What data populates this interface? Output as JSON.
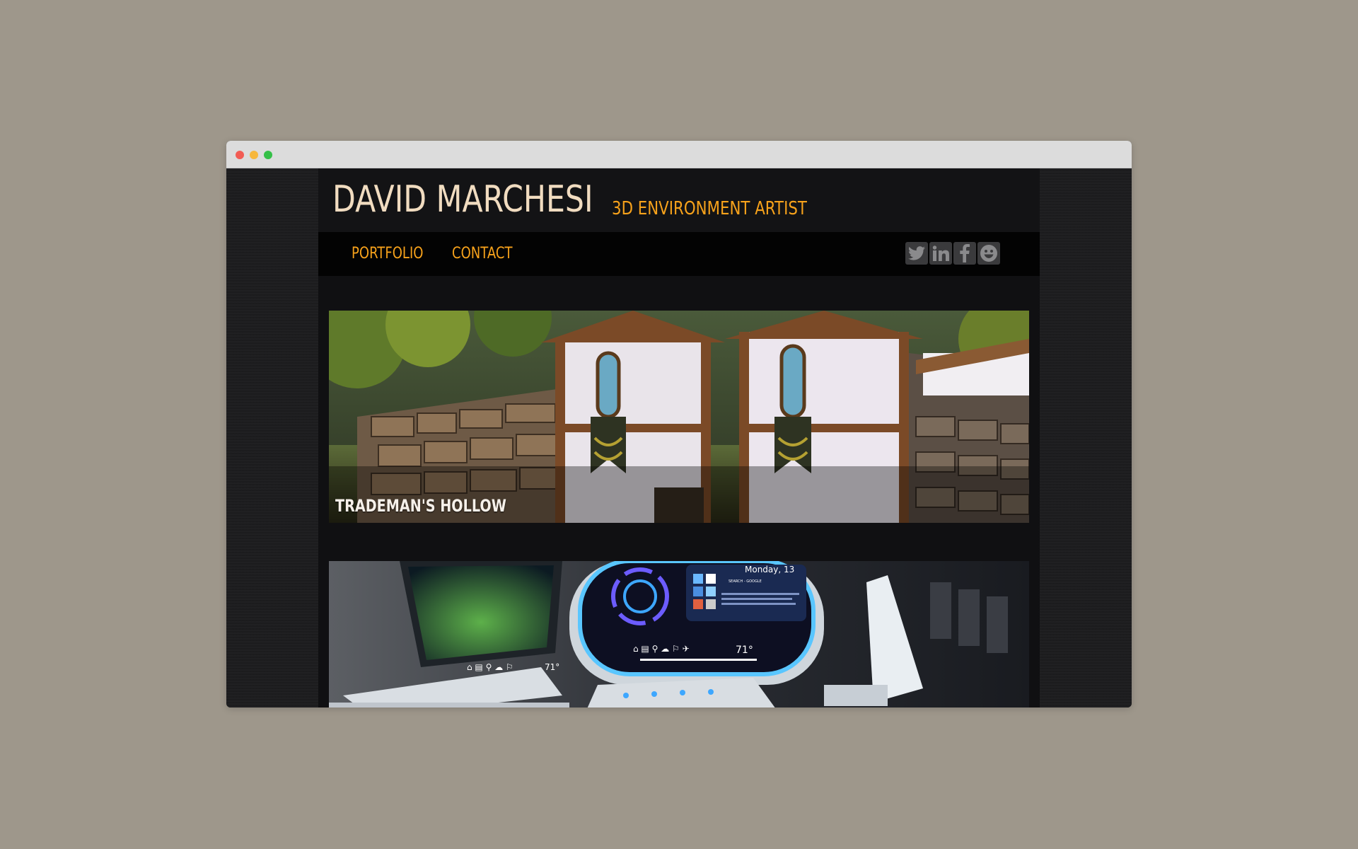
{
  "site": {
    "name": "DAVID MARCHESI",
    "role": "3D ENVIRONMENT ARTIST"
  },
  "nav": {
    "links": [
      "PORTFOLIO",
      "CONTACT"
    ]
  },
  "social": [
    "twitter-icon",
    "linkedin-icon",
    "facebook-icon",
    "smiley-icon"
  ],
  "projects": [
    {
      "title": "TRADEMAN'S HOLLOW"
    },
    {
      "title": "",
      "screen": {
        "day": "Monday, 13",
        "search": "SEARCH - GOOGLE",
        "temp": "71°"
      }
    }
  ],
  "colors": {
    "accent": "#f7a21b",
    "title": "#f1dcc0",
    "nav_bg": "#030303",
    "page_bg": "#101012",
    "backdrop": "#9e978b"
  }
}
